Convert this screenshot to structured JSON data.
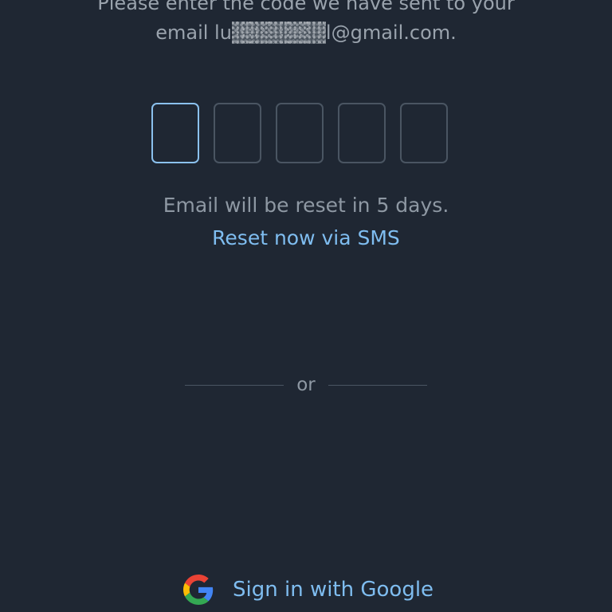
{
  "instructions": {
    "line1": "Please enter the code we have sent to your",
    "email_prefix": "email lu",
    "email_suffix": "l@gmail.com."
  },
  "code": {
    "length": 5,
    "active_index": 0
  },
  "reset_note": "Email will be reset in 5 days.",
  "sms_link": "Reset now via SMS",
  "divider_text": "or",
  "google": {
    "label": "Sign in with Google",
    "icon": "google-g-icon"
  },
  "colors": {
    "background": "#1f2733",
    "accent": "#7fbdf0",
    "active_box_border": "#8bc1ee",
    "box_border": "#4a5562",
    "muted_text": "#8e98a3"
  }
}
